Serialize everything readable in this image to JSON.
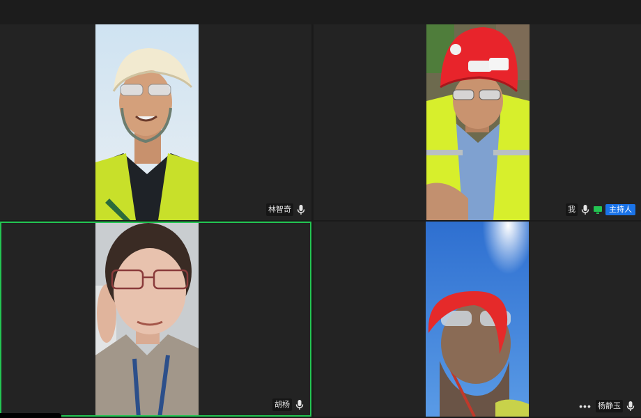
{
  "window": {
    "title": ""
  },
  "participants": [
    {
      "name": "林智奇",
      "mic_icon": "mic-icon",
      "role_badge": ""
    },
    {
      "name": "我",
      "mic_icon": "mic-icon",
      "role_badge": "主持人",
      "extra_icon": "screen-share-icon"
    },
    {
      "name": "胡杨",
      "mic_icon": "mic-icon",
      "role_badge": "",
      "active_speaker": true
    },
    {
      "name": "杨静玉",
      "mic_icon": "mic-icon",
      "role_badge": "",
      "more_label": "•••"
    }
  ],
  "colors": {
    "active_border": "#23c552",
    "host_badge": "#1a73e8",
    "tile_bg": "#232323"
  }
}
